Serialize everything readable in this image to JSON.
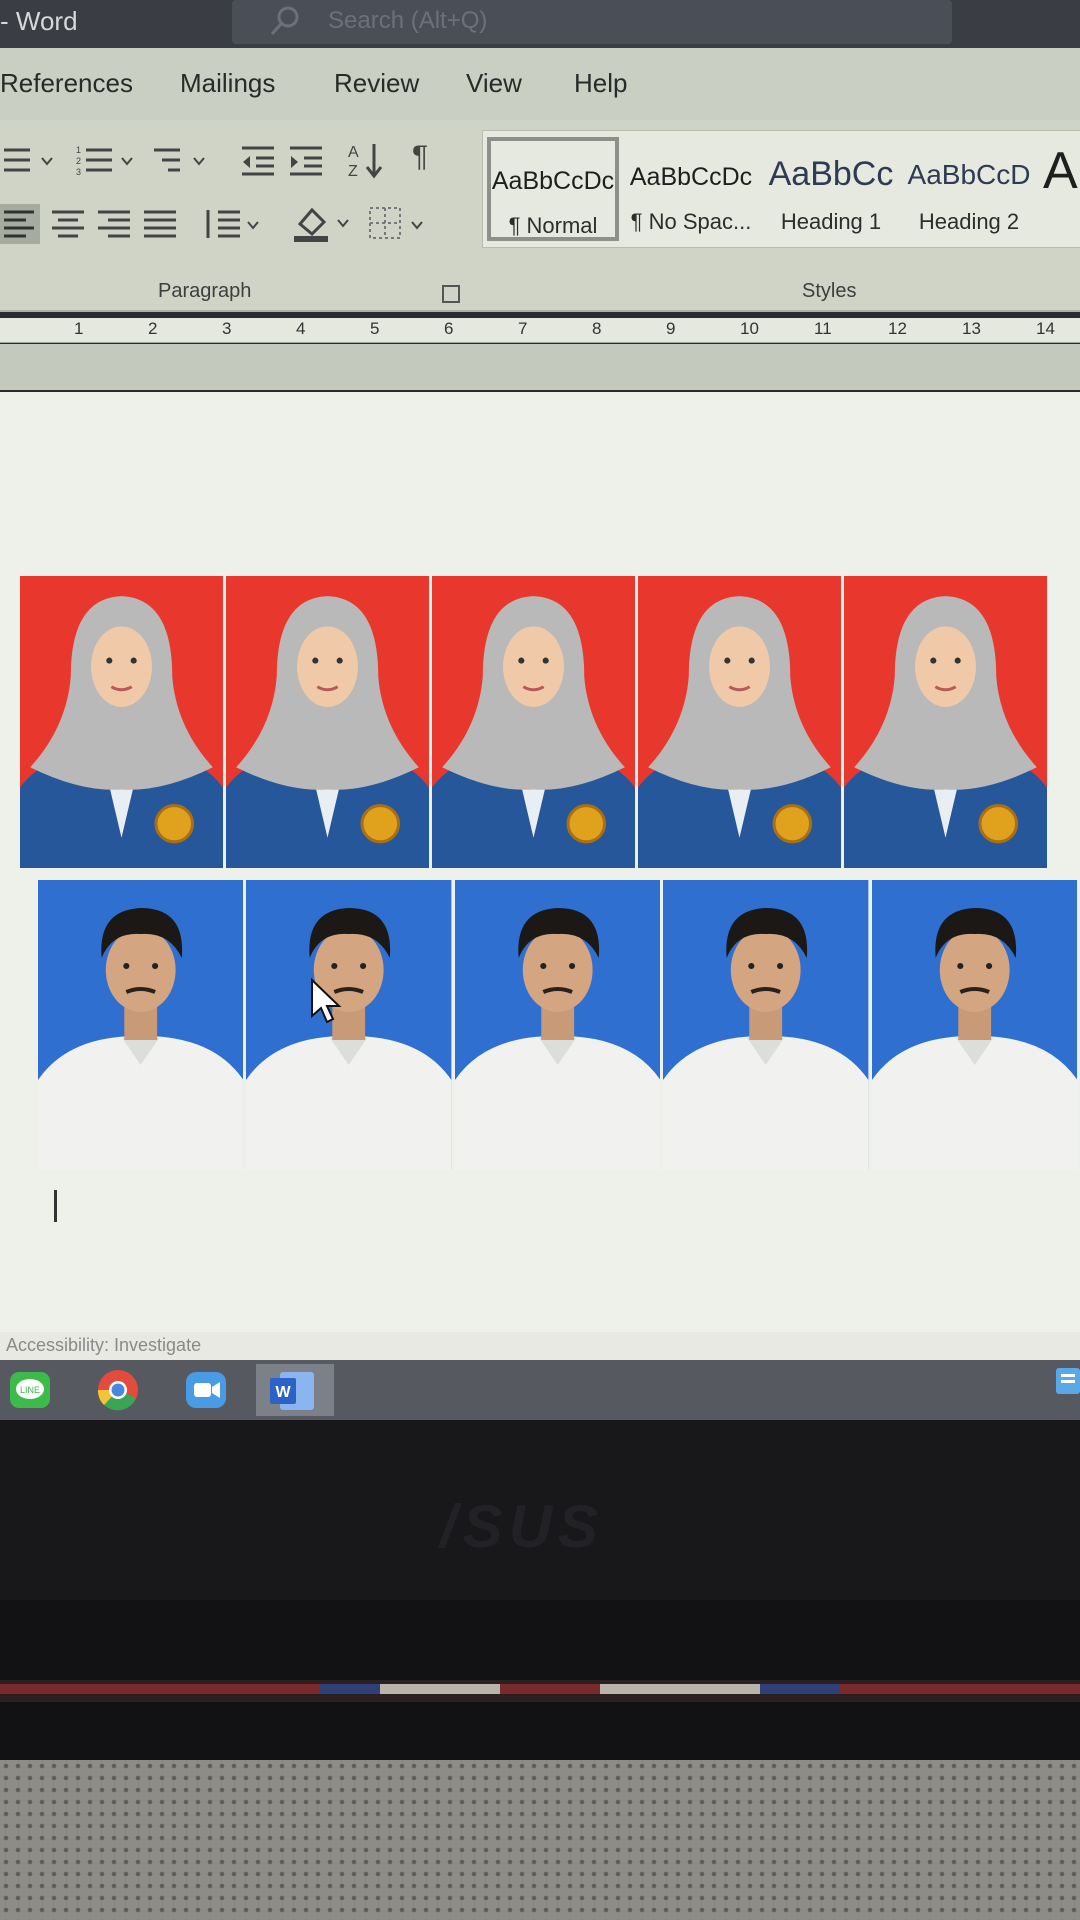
{
  "window": {
    "app_name": "- Word",
    "search_placeholder": "Search (Alt+Q)"
  },
  "ribbon_tabs": [
    "References",
    "Mailings",
    "Review",
    "View",
    "Help"
  ],
  "ribbon": {
    "paragraph_group_label": "Paragraph",
    "styles_group_label": "Styles",
    "styles": [
      {
        "sample": "AaBbCcDc",
        "name": "¶ Normal",
        "selected": true
      },
      {
        "sample": "AaBbCcDc",
        "name": "¶ No Spac...",
        "selected": false
      },
      {
        "sample": "AaBbCc",
        "name": "Heading 1",
        "selected": false
      },
      {
        "sample": "AaBbCcD",
        "name": "Heading 2",
        "selected": false
      },
      {
        "sample": "A",
        "name": "",
        "selected": false
      }
    ]
  },
  "ruler": {
    "numbers": [
      "1",
      "2",
      "3",
      "4",
      "5",
      "6",
      "7",
      "8",
      "9",
      "10",
      "11",
      "12",
      "13",
      "14"
    ]
  },
  "document": {
    "photo_rows": [
      {
        "background": "#e8382e",
        "count": 5,
        "subject": "hijab-portrait"
      },
      {
        "background": "#2f6fd0",
        "count": 5,
        "subject": "male-portrait"
      }
    ]
  },
  "status_bar": {
    "accessibility": "Accessibility: Investigate"
  },
  "taskbar": {
    "apps": [
      "line-icon",
      "chrome-icon",
      "zoom-icon",
      "word-icon"
    ]
  },
  "laptop": {
    "brand": "/SUS"
  },
  "colors": {
    "red_background": "#e8382e",
    "blue_background": "#2f6fd0",
    "jacket": "#26579a",
    "hijab": "#b9b9b9"
  }
}
